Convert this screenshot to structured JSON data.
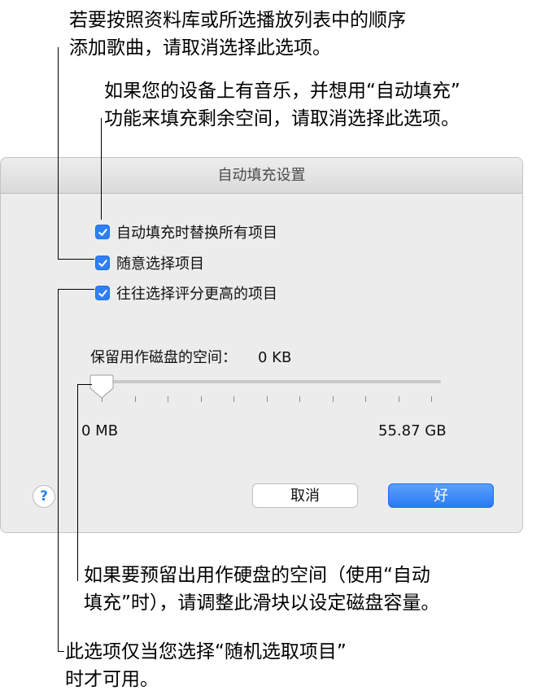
{
  "callouts": {
    "shuffle_order": [
      "若要按照资料库或所选播放列表中的顺序",
      "添加歌曲，请取消选择此选项。"
    ],
    "replace_all": [
      "如果您的设备上有音乐，并想用“自动填充”",
      "功能来填充剩余空间，请取消选择此选项。"
    ],
    "reserve_space": [
      "如果要预留出用作硬盘的空间（使用“自动",
      "填充”时），请调整此滑块以设定磁盘容量。"
    ],
    "higher_rated": [
      "此选项仅当您选择“随机选取项目”",
      "时才可用。"
    ]
  },
  "dialog": {
    "title": "自动填充设置",
    "checkboxes": [
      {
        "label": "自动填充时替换所有项目",
        "checked": true
      },
      {
        "label": "随意选择项目",
        "checked": true
      },
      {
        "label": "往往选择评分更高的项目",
        "checked": true
      }
    ],
    "reserve": {
      "label": "保留用作磁盘的空间：",
      "value": "0 KB",
      "fraction": 0.0
    },
    "slider": {
      "min_label": "0 MB",
      "max_label": "55.87 GB",
      "tick_count": 11
    },
    "help_label": "?",
    "cancel_label": "取消",
    "ok_label": "好"
  },
  "colors": {
    "accent": "#2f7ff5",
    "dialog_bg": "#ececec"
  }
}
